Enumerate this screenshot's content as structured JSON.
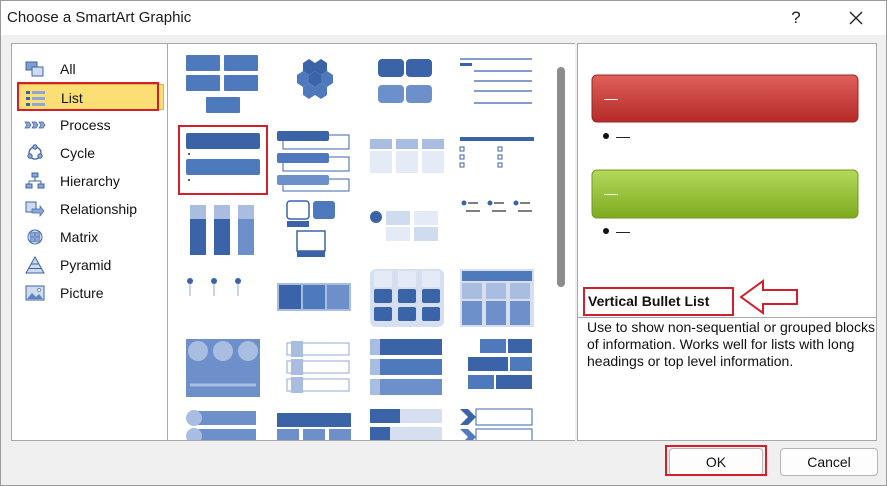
{
  "window": {
    "title": "Choose a SmartArt Graphic",
    "help_glyph": "?",
    "close_icon": "close-icon"
  },
  "categories": [
    {
      "label": "All",
      "icon": "all-icon",
      "selected": false
    },
    {
      "label": "List",
      "icon": "list-icon",
      "selected": true
    },
    {
      "label": "Process",
      "icon": "process-icon",
      "selected": false
    },
    {
      "label": "Cycle",
      "icon": "cycle-icon",
      "selected": false
    },
    {
      "label": "Hierarchy",
      "icon": "hierarchy-icon",
      "selected": false
    },
    {
      "label": "Relationship",
      "icon": "relationship-icon",
      "selected": false
    },
    {
      "label": "Matrix",
      "icon": "matrix-icon",
      "selected": false
    },
    {
      "label": "Pyramid",
      "icon": "pyramid-icon",
      "selected": false
    },
    {
      "label": "Picture",
      "icon": "picture-icon",
      "selected": false
    }
  ],
  "selected_layout": {
    "name": "Vertical Bullet List",
    "description": "Use to show non-sequential or grouped blocks of information. Works well for lists with long headings or top level information."
  },
  "preview": {
    "shape1_color": "#c8312e",
    "shape2_color": "#8fbd2c",
    "dash": "—"
  },
  "buttons": {
    "ok": "OK",
    "cancel": "Cancel"
  },
  "colors": {
    "highlight": "#fbdf74",
    "annotation_red": "#d1202b",
    "smartart_blue": "#3b64a8"
  }
}
